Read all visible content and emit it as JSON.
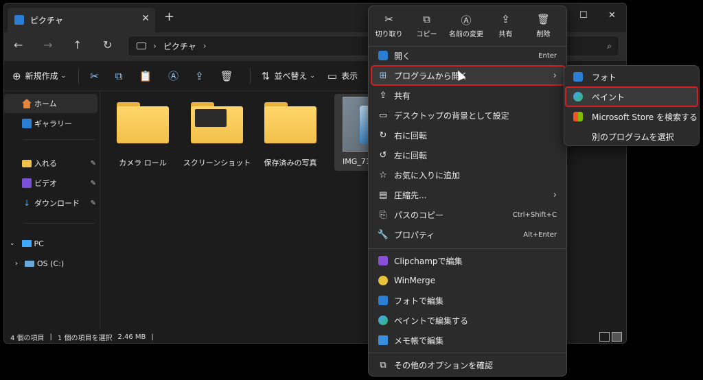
{
  "window": {
    "tab_title": "ピクチャ",
    "tab_close": "✕",
    "new_tab": "+",
    "controls": {
      "minimize": "—",
      "maximize": "☐",
      "close": "✕"
    }
  },
  "nav": {
    "back": "←",
    "forward": "→",
    "up": "↑",
    "refresh": "↻",
    "breadcrumb": [
      "ピクチャ"
    ],
    "search_icon": "⌕"
  },
  "toolbar": {
    "new_label": "新規作成",
    "sort_label": "並べ替え",
    "view_label": "表示"
  },
  "sidebar": {
    "items": [
      {
        "label": "ホーム",
        "icon": "home-icon",
        "selected": true
      },
      {
        "label": "ギャラリー",
        "icon": "gallery-icon"
      },
      {
        "label": "入れる",
        "icon": "folder-icon",
        "pinned": true
      },
      {
        "label": "ビデオ",
        "icon": "video-icon",
        "pinned": true
      },
      {
        "label": "ダウンロード",
        "icon": "download-icon",
        "pinned": true
      },
      {
        "label": "PC",
        "icon": "pc-icon",
        "expanded": true
      },
      {
        "label": "OS (C:)",
        "icon": "drive-icon"
      }
    ],
    "pin_glyph": "📌"
  },
  "content": {
    "items": [
      {
        "label": "カメラ ロール",
        "kind": "folder"
      },
      {
        "label": "スクリーンショット",
        "kind": "folder"
      },
      {
        "label": "保存済みの写真",
        "kind": "folder"
      },
      {
        "label": "IMG_716",
        "kind": "image"
      }
    ]
  },
  "status": {
    "count": "4 個の項目",
    "selected": "1 個の項目を選択",
    "size": "2.46 MB"
  },
  "context_menu": {
    "quick": [
      {
        "label": "切り取り",
        "icon": "cut-icon",
        "glyph": "✂"
      },
      {
        "label": "コピー",
        "icon": "copy-icon",
        "glyph": "⧉"
      },
      {
        "label": "名前の変更",
        "icon": "rename-icon",
        "glyph": "Ⓐ"
      },
      {
        "label": "共有",
        "icon": "share-icon",
        "glyph": "⇪"
      },
      {
        "label": "削除",
        "icon": "delete-icon",
        "glyph": "🗑"
      }
    ],
    "items": [
      {
        "label": "開く",
        "shortcut": "Enter"
      },
      {
        "label": "プログラムから開く",
        "arrow": "›"
      },
      {
        "label": "共有"
      },
      {
        "label": "デスクトップの背景として設定"
      },
      {
        "label": "右に回転"
      },
      {
        "label": "左に回転"
      },
      {
        "label": "お気に入りに追加"
      },
      {
        "label": "圧縮先...",
        "arrow": "›"
      },
      {
        "label": "パスのコピー",
        "shortcut": "Ctrl+Shift+C"
      },
      {
        "label": "プロパティ",
        "shortcut": "Alt+Enter"
      },
      {
        "label": "Clipchampで編集"
      },
      {
        "label": "WinMerge"
      },
      {
        "label": "フォトで編集"
      },
      {
        "label": "ペイントで編集する"
      },
      {
        "label": "メモ帳で編集"
      },
      {
        "label": "その他のオプションを確認"
      }
    ]
  },
  "submenu": {
    "items": [
      {
        "label": "フォト"
      },
      {
        "label": "ペイント"
      },
      {
        "label": "Microsoft Store を検索する"
      },
      {
        "label": "別のプログラムを選択"
      }
    ]
  },
  "colors": {
    "accent": "#0a84ff",
    "highlight_border": "#d71e25",
    "folder": "#f2c04a"
  }
}
